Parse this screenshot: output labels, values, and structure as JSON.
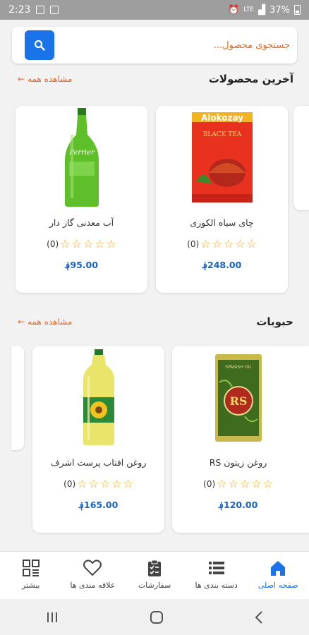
{
  "status": {
    "time": "2:23",
    "battery": "37%",
    "network": "LTE"
  },
  "search": {
    "placeholder": "جستجوی محصول..."
  },
  "sections": [
    {
      "title": "آخرین محصولات",
      "view_all": "مشاهده همه",
      "products": [
        {
          "name": "چای سیاه الکوزی",
          "rating_count": "(0)",
          "price": "248.00؋",
          "image_text": "Alokozay",
          "image_sub": "BLACK TEA"
        },
        {
          "name": "آب معدنی گاز دار",
          "rating_count": "(0)",
          "price": "95.00؋",
          "image_text": "Perrier"
        }
      ]
    },
    {
      "title": "حبوبات",
      "view_all": "مشاهده همه",
      "products": [
        {
          "name": "روغن  زیتون RS",
          "rating_count": "(0)",
          "price": "120.00؋",
          "image_text": "RS",
          "image_sub": "SPANISH OIL"
        },
        {
          "name": "روغن  افتاب پرست اشرف",
          "rating_count": "(0)",
          "price": "165.00؋"
        }
      ]
    }
  ],
  "nav": [
    {
      "label": "صفحه اصلی",
      "icon": "home-icon",
      "active": true
    },
    {
      "label": "دسته بندی ها",
      "icon": "list-icon",
      "active": false
    },
    {
      "label": "سفارشات",
      "icon": "clipboard-icon",
      "active": false
    },
    {
      "label": "علاقه مندی ها",
      "icon": "heart-icon",
      "active": false
    },
    {
      "label": "بیشتر",
      "icon": "grid-icon",
      "active": false
    }
  ],
  "colors": {
    "accent": "#1a73e8",
    "orange": "#e06a2b",
    "price": "#1a62c7",
    "star": "#f1a51f"
  }
}
